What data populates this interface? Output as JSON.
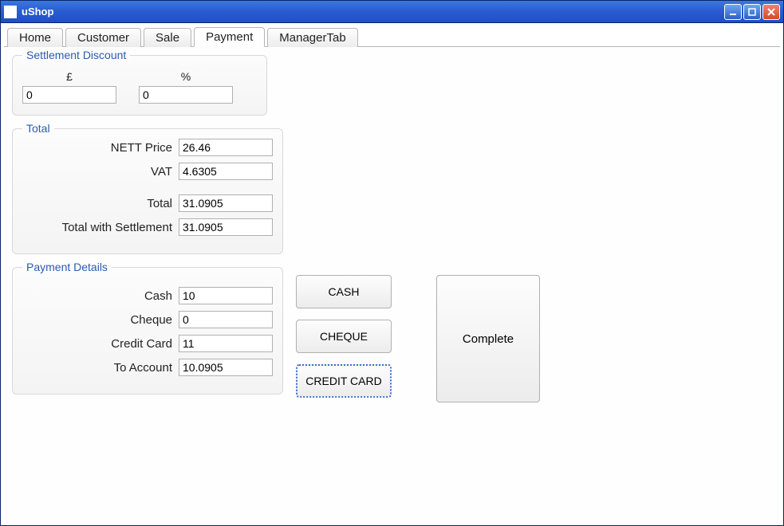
{
  "window": {
    "title": "uShop"
  },
  "tabs": [
    {
      "label": "Home",
      "active": false
    },
    {
      "label": "Customer",
      "active": false
    },
    {
      "label": "Sale",
      "active": false
    },
    {
      "label": "Payment",
      "active": true
    },
    {
      "label": "ManagerTab",
      "active": false
    }
  ],
  "settlement": {
    "legend": "Settlement Discount",
    "pound_label": "£",
    "percent_label": "%",
    "pound_value": "0",
    "percent_value": "0"
  },
  "total": {
    "legend": "Total",
    "nett_label": "NETT Price",
    "nett_value": "26.46",
    "vat_label": "VAT",
    "vat_value": "4.6305",
    "total_label": "Total",
    "total_value": "31.0905",
    "total_settle_label": "Total with Settlement",
    "total_settle_value": "31.0905"
  },
  "payment": {
    "legend": "Payment Details",
    "cash_label": "Cash",
    "cash_value": "10",
    "cheque_label": "Cheque",
    "cheque_value": "0",
    "credit_label": "Credit Card",
    "credit_value": "11",
    "account_label": "To Account",
    "account_value": "10.0905"
  },
  "buttons": {
    "cash": "CASH",
    "cheque": "CHEQUE",
    "credit": "CREDIT CARD",
    "complete": "Complete"
  }
}
